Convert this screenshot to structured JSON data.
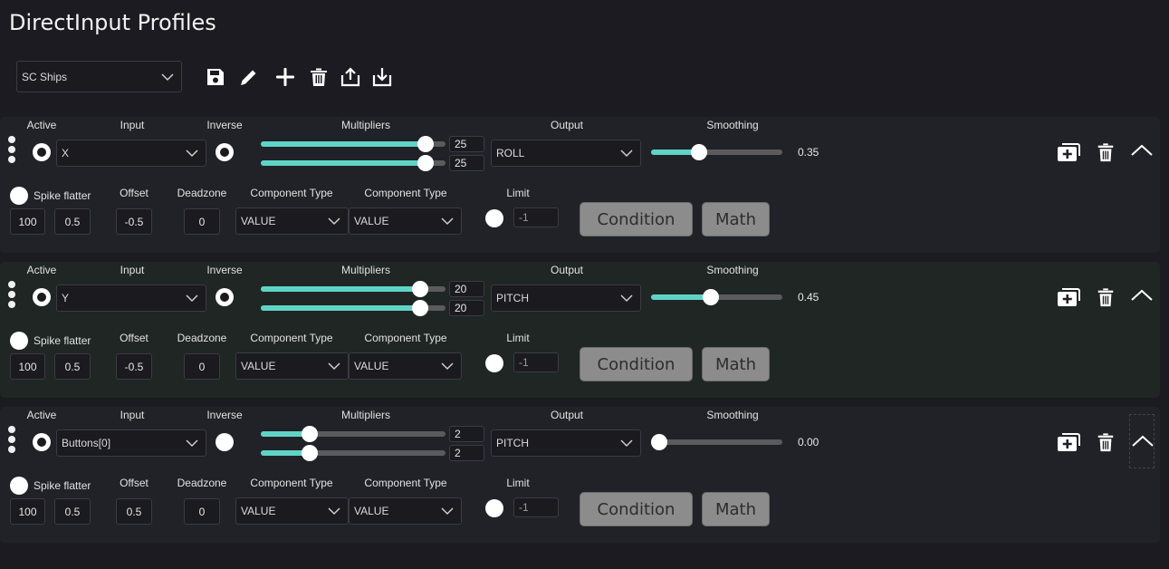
{
  "header": {
    "title": "DirectInput Profiles"
  },
  "profile_selector": {
    "value": "SC Ships"
  },
  "toolbar": [
    "save-icon",
    "edit-icon",
    "add-icon",
    "delete-icon",
    "export-icon",
    "import-icon"
  ],
  "labels": {
    "active": "Active",
    "input": "Input",
    "inverse": "Inverse",
    "multipliers": "Multipliers",
    "output": "Output",
    "smoothing": "Smoothing",
    "spike_flatter": "Spike flatter",
    "offset": "Offset",
    "deadzone": "Deadzone",
    "component_type": "Component Type",
    "limit": "Limit",
    "condition": "Condition",
    "math": "Math"
  },
  "rows": [
    {
      "active": true,
      "input": "X",
      "inverse": true,
      "multiplier_1": "25",
      "multiplier_2": "25",
      "multiplier_fraction": 0.93,
      "output": "ROLL",
      "smoothing": "0.35",
      "smoothing_fraction": 0.35,
      "spike_flatter_on": false,
      "spike_a": "100",
      "spike_b": "0.5",
      "offset": "-0.5",
      "deadzone": "0",
      "component_type_1": "VALUE",
      "component_type_2": "VALUE",
      "limit_on": false,
      "limit": "-1"
    },
    {
      "active": true,
      "input": "Y",
      "inverse": true,
      "multiplier_1": "20",
      "multiplier_2": "20",
      "multiplier_fraction": 0.9,
      "output": "PITCH",
      "smoothing": "0.45",
      "smoothing_fraction": 0.45,
      "spike_flatter_on": false,
      "spike_a": "100",
      "spike_b": "0.5",
      "offset": "-0.5",
      "deadzone": "0",
      "component_type_1": "VALUE",
      "component_type_2": "VALUE",
      "limit_on": false,
      "limit": "-1"
    },
    {
      "active": true,
      "input": "Buttons[0]",
      "inverse": false,
      "multiplier_1": "2",
      "multiplier_2": "2",
      "multiplier_fraction": 0.24,
      "output": "PITCH",
      "smoothing": "0.00",
      "smoothing_fraction": 0.0,
      "spike_flatter_on": false,
      "spike_a": "100",
      "spike_b": "0.5",
      "offset": "0.5",
      "deadzone": "0",
      "component_type_1": "VALUE",
      "component_type_2": "VALUE",
      "limit_on": false,
      "limit": "-1"
    }
  ],
  "colors": {
    "accent": "#5fd4c6",
    "background": "#1c1b21",
    "panel": "#212128",
    "panel_selected": "#1f2624",
    "button": "#8c8c8c"
  }
}
